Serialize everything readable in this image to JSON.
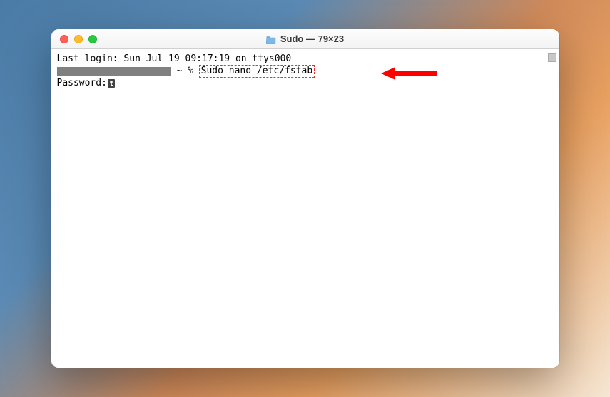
{
  "window": {
    "title": "Sudo — 79×23"
  },
  "terminal": {
    "line1": "Last login: Sun Jul 19 09:17:19 on ttys000",
    "prompt_suffix": " ~ % ",
    "command": "Sudo nano /etc/fstab",
    "line3_prefix": "Password:"
  }
}
